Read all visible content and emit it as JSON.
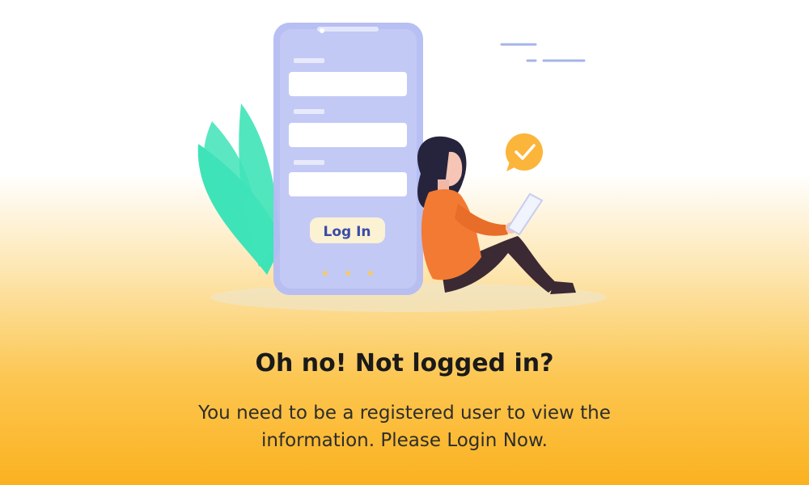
{
  "illustration": {
    "login_button_label": "Log In",
    "icons": [
      "leaf-icon",
      "phone-icon",
      "checkmark-bubble-icon",
      "tablet-icon"
    ],
    "colors": {
      "phone": "#b4bcf2",
      "leaf": "#3fe3b8",
      "shirt": "#f37a33",
      "pants": "#3b2a33",
      "hair": "#26243d",
      "check_bubble": "#fbb53b"
    }
  },
  "heading": "Oh no! Not logged in?",
  "message": "You need to be a registered user to view the information. Please Login Now."
}
